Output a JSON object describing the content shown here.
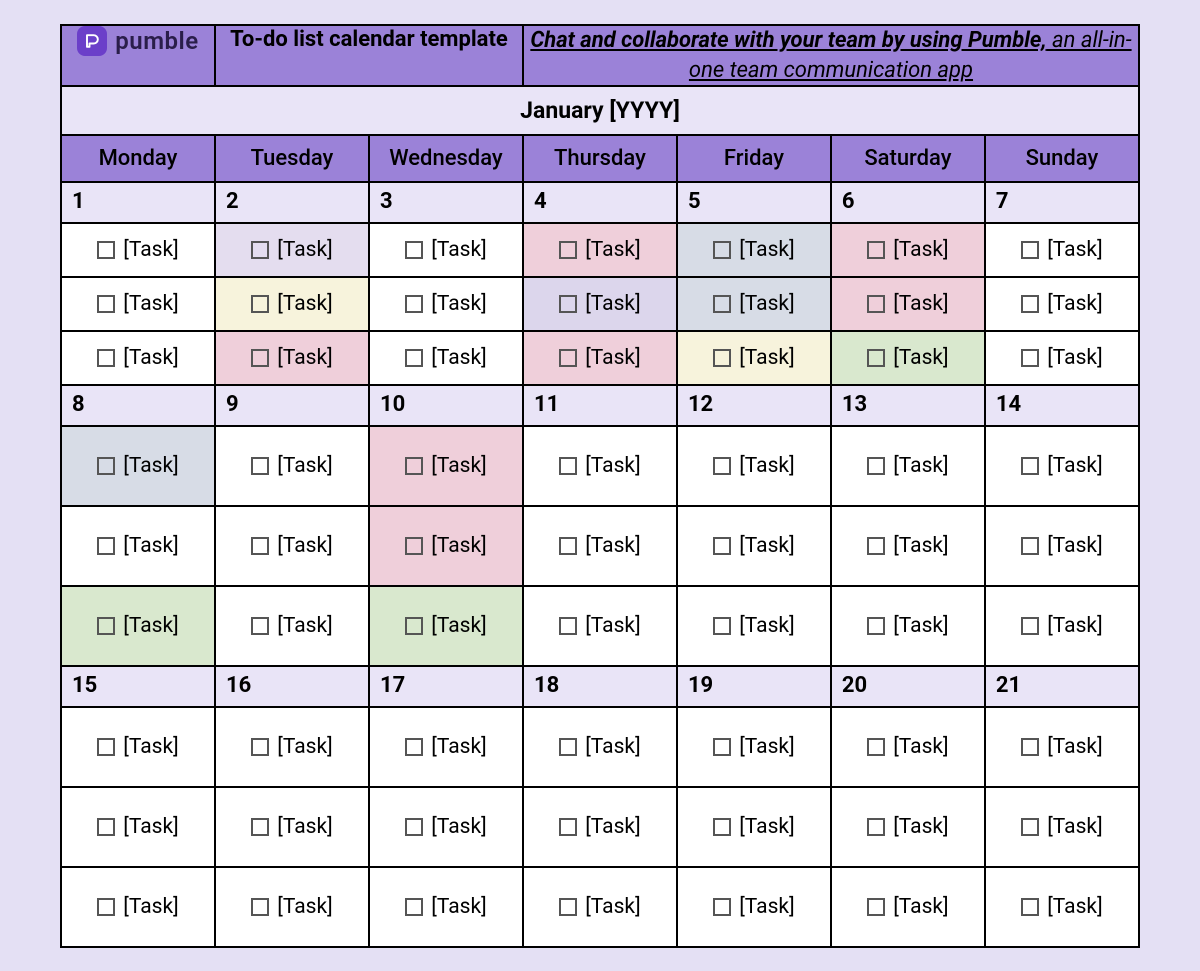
{
  "brand": {
    "name": "pumble",
    "icon": "pumble-logo"
  },
  "template_title": "To-do list calendar template",
  "promo": {
    "bold_text": "Chat and collaborate with your team by using Pumble,",
    "tail_text": " an all-in-one team communication app"
  },
  "month_label": "January [YYYY]",
  "days_of_week": [
    "Monday",
    "Tuesday",
    "Wednesday",
    "Thursday",
    "Friday",
    "Saturday",
    "Sunday"
  ],
  "task_placeholder": "[Task]",
  "colors": {
    "header_purple": "#9B82D8",
    "light_lav": "#E9E4F7",
    "page_bg": "#E4E0F4",
    "sh_lilac": "#E4DDEF",
    "sh_lav": "#DCD6EC",
    "sh_blue": "#D7DCE6",
    "sh_pink": "#EFCFDA",
    "sh_ivory": "#F7F3DC",
    "sh_green": "#D9E8CE"
  },
  "weeks": [
    {
      "dates": [
        "1",
        "2",
        "3",
        "4",
        "5",
        "6",
        "7"
      ],
      "tall_rows": false,
      "tasks": [
        [
          {
            "c": "white"
          },
          {
            "c": "lilac"
          },
          {
            "c": "white"
          },
          {
            "c": "pink"
          },
          {
            "c": "blue"
          },
          {
            "c": "pink"
          },
          {
            "c": "white"
          }
        ],
        [
          {
            "c": "white"
          },
          {
            "c": "ivory"
          },
          {
            "c": "white"
          },
          {
            "c": "lav"
          },
          {
            "c": "blue"
          },
          {
            "c": "pink"
          },
          {
            "c": "white"
          }
        ],
        [
          {
            "c": "white"
          },
          {
            "c": "pink"
          },
          {
            "c": "white"
          },
          {
            "c": "pink"
          },
          {
            "c": "ivory"
          },
          {
            "c": "green"
          },
          {
            "c": "white"
          }
        ]
      ]
    },
    {
      "dates": [
        "8",
        "9",
        "10",
        "11",
        "12",
        "13",
        "14"
      ],
      "tall_rows": true,
      "tasks": [
        [
          {
            "c": "blue"
          },
          {
            "c": "white"
          },
          {
            "c": "pink"
          },
          {
            "c": "white"
          },
          {
            "c": "white"
          },
          {
            "c": "white"
          },
          {
            "c": "white"
          }
        ],
        [
          {
            "c": "white"
          },
          {
            "c": "white"
          },
          {
            "c": "pink"
          },
          {
            "c": "white"
          },
          {
            "c": "white"
          },
          {
            "c": "white"
          },
          {
            "c": "white"
          }
        ],
        [
          {
            "c": "green"
          },
          {
            "c": "white"
          },
          {
            "c": "green"
          },
          {
            "c": "white"
          },
          {
            "c": "white"
          },
          {
            "c": "white"
          },
          {
            "c": "white"
          }
        ]
      ]
    },
    {
      "dates": [
        "15",
        "16",
        "17",
        "18",
        "19",
        "20",
        "21"
      ],
      "tall_rows": true,
      "tasks": [
        [
          {
            "c": "white"
          },
          {
            "c": "white"
          },
          {
            "c": "white"
          },
          {
            "c": "white"
          },
          {
            "c": "white"
          },
          {
            "c": "white"
          },
          {
            "c": "white"
          }
        ],
        [
          {
            "c": "white"
          },
          {
            "c": "white"
          },
          {
            "c": "white"
          },
          {
            "c": "white"
          },
          {
            "c": "white"
          },
          {
            "c": "white"
          },
          {
            "c": "white"
          }
        ],
        [
          {
            "c": "white"
          },
          {
            "c": "white"
          },
          {
            "c": "white"
          },
          {
            "c": "white"
          },
          {
            "c": "white"
          },
          {
            "c": "white"
          },
          {
            "c": "white"
          }
        ]
      ]
    }
  ]
}
